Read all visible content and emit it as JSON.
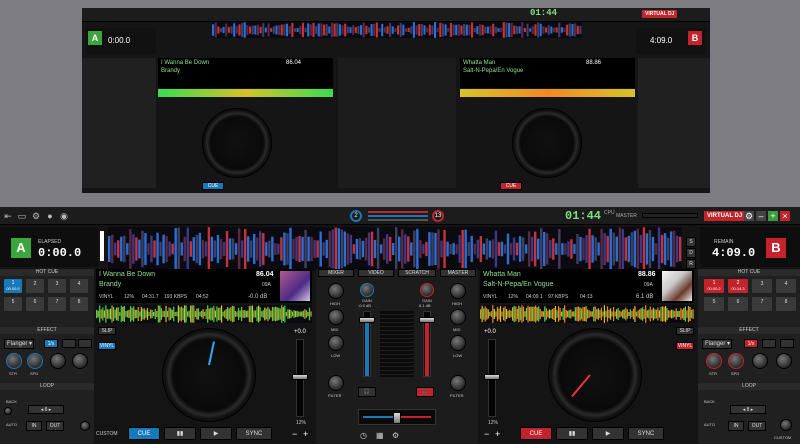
{
  "colors": {
    "accent_blue": "#1779b9",
    "accent_red": "#c3232c",
    "wave_green": "#3adb52",
    "wave_orange": "#ef8a25",
    "clock": "#7fe07f",
    "deck_a": "#3da53d",
    "deck_b": "#c3232c"
  },
  "toolbar": {
    "clock": "01:44",
    "cpu": "CPU",
    "master": "MASTER",
    "brand": "VIRTUAL DJ",
    "left_counter": "2",
    "right_counter": "13"
  },
  "deck_a": {
    "letter": "A",
    "time_label": "ELAPSED",
    "time": "0:00.0",
    "title": "I Wanna Be Down",
    "artist": "Brandy",
    "bpm": "86.04",
    "key": "09A",
    "vinyl": "VINYL",
    "pitch": "12%",
    "length": "04:31.7",
    "bitrate": "193 KBPS",
    "remain": "04:52",
    "gain_db": "-0.0 dB",
    "hotcue_label": "HOT CUE",
    "hotcues": [
      "1",
      "2",
      "3",
      "4",
      "5",
      "6",
      "7",
      "8"
    ],
    "hotcue_time": "00:00.5",
    "effect_label": "EFFECT",
    "effect_name": "Flanger",
    "effect_tab": "1/x",
    "str": "STR",
    "spd": "SPD",
    "loop_label": "LOOP",
    "back": "BACK",
    "loop_len": "8",
    "in": "IN",
    "out": "OUT",
    "custom": "CUSTOM",
    "auto": "AUTO",
    "slip": "SLIP",
    "vinyl_btn": "VINYL",
    "cue": "CUE",
    "play": "▶",
    "pause": "▮▮",
    "sync": "SYNC",
    "pitch_plus": "+0.0",
    "pitch_pct": "12%",
    "minus": "−",
    "plus": "+"
  },
  "deck_b": {
    "letter": "B",
    "time_label": "REMAIN",
    "time": "4:09.0",
    "title": "Whatta Man",
    "artist": "Salt-N-Pepa/En Vogue",
    "bpm": "88.86",
    "key": "09A",
    "vinyl": "VINYL",
    "pitch": "12%",
    "length": "04:09.1",
    "bitrate": "97 KBPS",
    "remain": "04:13",
    "gain_db": "6.1 dB",
    "hotcue_label": "HOT CUE",
    "hotcues": [
      "1",
      "2",
      "3",
      "4",
      "5",
      "6",
      "7",
      "8"
    ],
    "hotcue_time": "00:14.3",
    "hotcue_time2": "00:00.2",
    "effect_label": "EFFECT",
    "effect_name": "Flanger",
    "effect_tab": "1/x",
    "str": "STR",
    "spd": "SPD",
    "loop_label": "LOOP",
    "back": "BACK",
    "loop_len": "8",
    "in": "IN",
    "out": "OUT",
    "custom": "CUSTOM",
    "auto": "AUTO",
    "slip": "SLIP",
    "vinyl_btn": "VINYL",
    "cue": "CUE",
    "play": "▶",
    "pause": "▮▮",
    "sync": "SYNC",
    "pitch_plus": "+0.0",
    "pitch_pct": "12%",
    "minus": "−",
    "plus": "+"
  },
  "mixer": {
    "tabs": [
      "MIXER",
      "VIDEO",
      "SCRATCH",
      "MASTER"
    ],
    "gain": "GAIN",
    "gain_a": "-0.0 dB",
    "gain_b": "6.1 dB",
    "high": "HIGH",
    "mid": "MID",
    "low": "LOW",
    "filter": "FILTER",
    "sdr": [
      "S",
      "D",
      "R"
    ],
    "headphone": "🎧"
  }
}
